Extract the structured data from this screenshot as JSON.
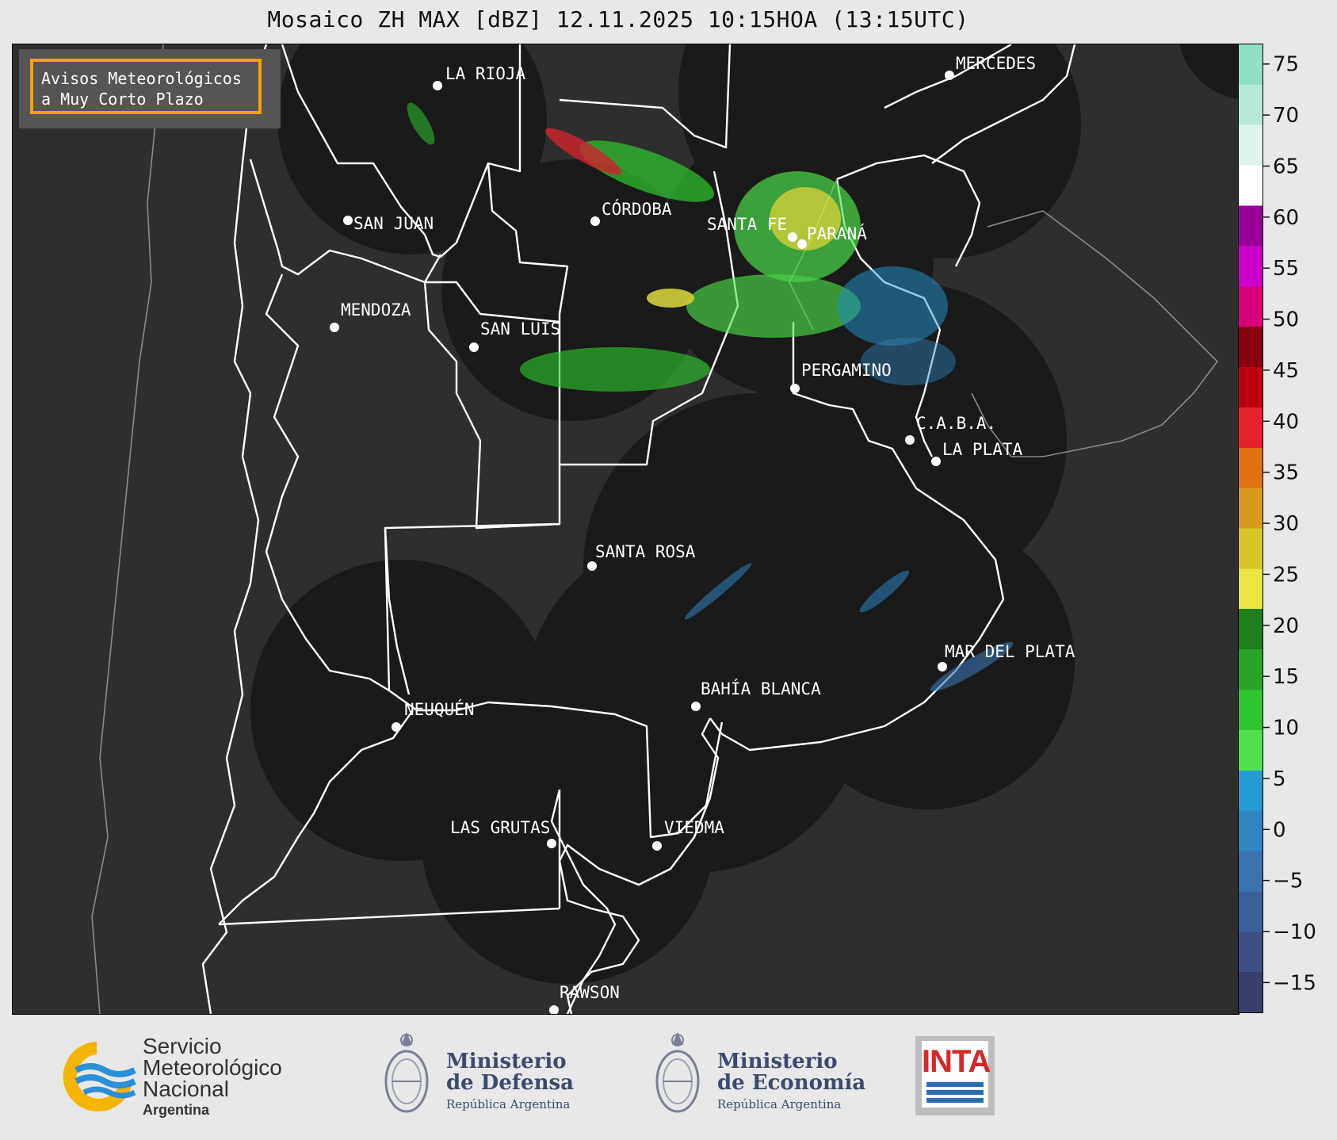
{
  "title": "Mosaico ZH MAX [dBZ] 12.11.2025 10:15HOA (13:15UTC)",
  "notice": {
    "line1": "Avisos Meteorológicos",
    "line2": "a Muy Corto Plazo",
    "border_color": "#f5a300"
  },
  "cities": [
    {
      "name": "LA RIOJA"
    },
    {
      "name": "MERCEDES"
    },
    {
      "name": "CÓRDOBA"
    },
    {
      "name": "SAN JUAN"
    },
    {
      "name": "SANTA FE"
    },
    {
      "name": "PARANÁ"
    },
    {
      "name": "MENDOZA"
    },
    {
      "name": "SAN LUIS"
    },
    {
      "name": "PERGAMINO"
    },
    {
      "name": "C.A.B.A."
    },
    {
      "name": "LA PLATA"
    },
    {
      "name": "SANTA ROSA"
    },
    {
      "name": "MAR DEL PLATA"
    },
    {
      "name": "BAHÍA BLANCA"
    },
    {
      "name": "NEUQUÉN"
    },
    {
      "name": "LAS GRUTAS"
    },
    {
      "name": "VIEDMA"
    },
    {
      "name": "RAWSON"
    }
  ],
  "colorbar": {
    "unit": "dBZ",
    "ticks": [
      "75",
      "70",
      "65",
      "60",
      "55",
      "50",
      "45",
      "40",
      "35",
      "30",
      "25",
      "20",
      "15",
      "10",
      "5",
      "0",
      "−5",
      "−10",
      "−15"
    ],
    "tick_values": [
      75,
      70,
      65,
      60,
      55,
      50,
      45,
      40,
      35,
      30,
      25,
      20,
      15,
      10,
      5,
      0,
      -5,
      -10,
      -15
    ],
    "range": [
      -18,
      77
    ],
    "colors": [
      "#3a3f6e",
      "#3f4f86",
      "#3d5f99",
      "#3a72ad",
      "#2f86c0",
      "#259bd3",
      "#4ee34c",
      "#2ec62e",
      "#2aa52a",
      "#1e7f1e",
      "#e8e640",
      "#d8c628",
      "#d79a1a",
      "#e07010",
      "#e3222e",
      "#bb0010",
      "#8a0010",
      "#d6007a",
      "#cc00cc",
      "#980098",
      "#ffffff",
      "#dff4ec",
      "#b7ead6",
      "#8fe0c4"
    ]
  },
  "footer": {
    "smn": {
      "line1": "Servicio",
      "line2": "Meteorológico",
      "line3": "Nacional",
      "line4": "Argentina"
    },
    "defensa": {
      "line1": "Ministerio",
      "line2": "de Defensa",
      "line3": "República Argentina"
    },
    "economia": {
      "line1": "Ministerio",
      "line2": "de Economía",
      "line3": "República Argentina"
    },
    "inta": {
      "word": "INTA"
    }
  }
}
